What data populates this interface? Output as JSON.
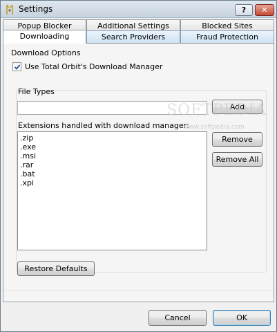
{
  "window": {
    "title": "Settings",
    "help_label": "?",
    "close_label": "✕"
  },
  "tabs": {
    "row1": [
      "Popup Blocker",
      "Additional Settings",
      "Blocked Sites"
    ],
    "row2": [
      "Downloading",
      "Search Providers",
      "Fraud Protection"
    ],
    "active": "Downloading"
  },
  "download_options": {
    "group_label": "Download Options",
    "use_manager_label": "Use Total Orbit's Download Manager",
    "use_manager_checked": true
  },
  "file_types": {
    "group_label": "File Types",
    "input_value": "",
    "add_label": "Add",
    "extensions_label": "Extensions handled with download manager:",
    "extensions": [
      ".zip",
      ".exe",
      ".msi",
      ".rar",
      ".bat",
      ".xpi"
    ],
    "remove_label": "Remove",
    "remove_all_label": "Remove All"
  },
  "restore_defaults_label": "Restore Defaults",
  "footer": {
    "cancel_label": "Cancel",
    "ok_label": "OK"
  },
  "watermark": {
    "text": "SOFTPEDIA",
    "url": "www.softpedia.com"
  },
  "colors": {
    "close_button": "#c74a35",
    "tab_row2": "#cfe3f4",
    "default_button_border": "#3c7fb1"
  }
}
